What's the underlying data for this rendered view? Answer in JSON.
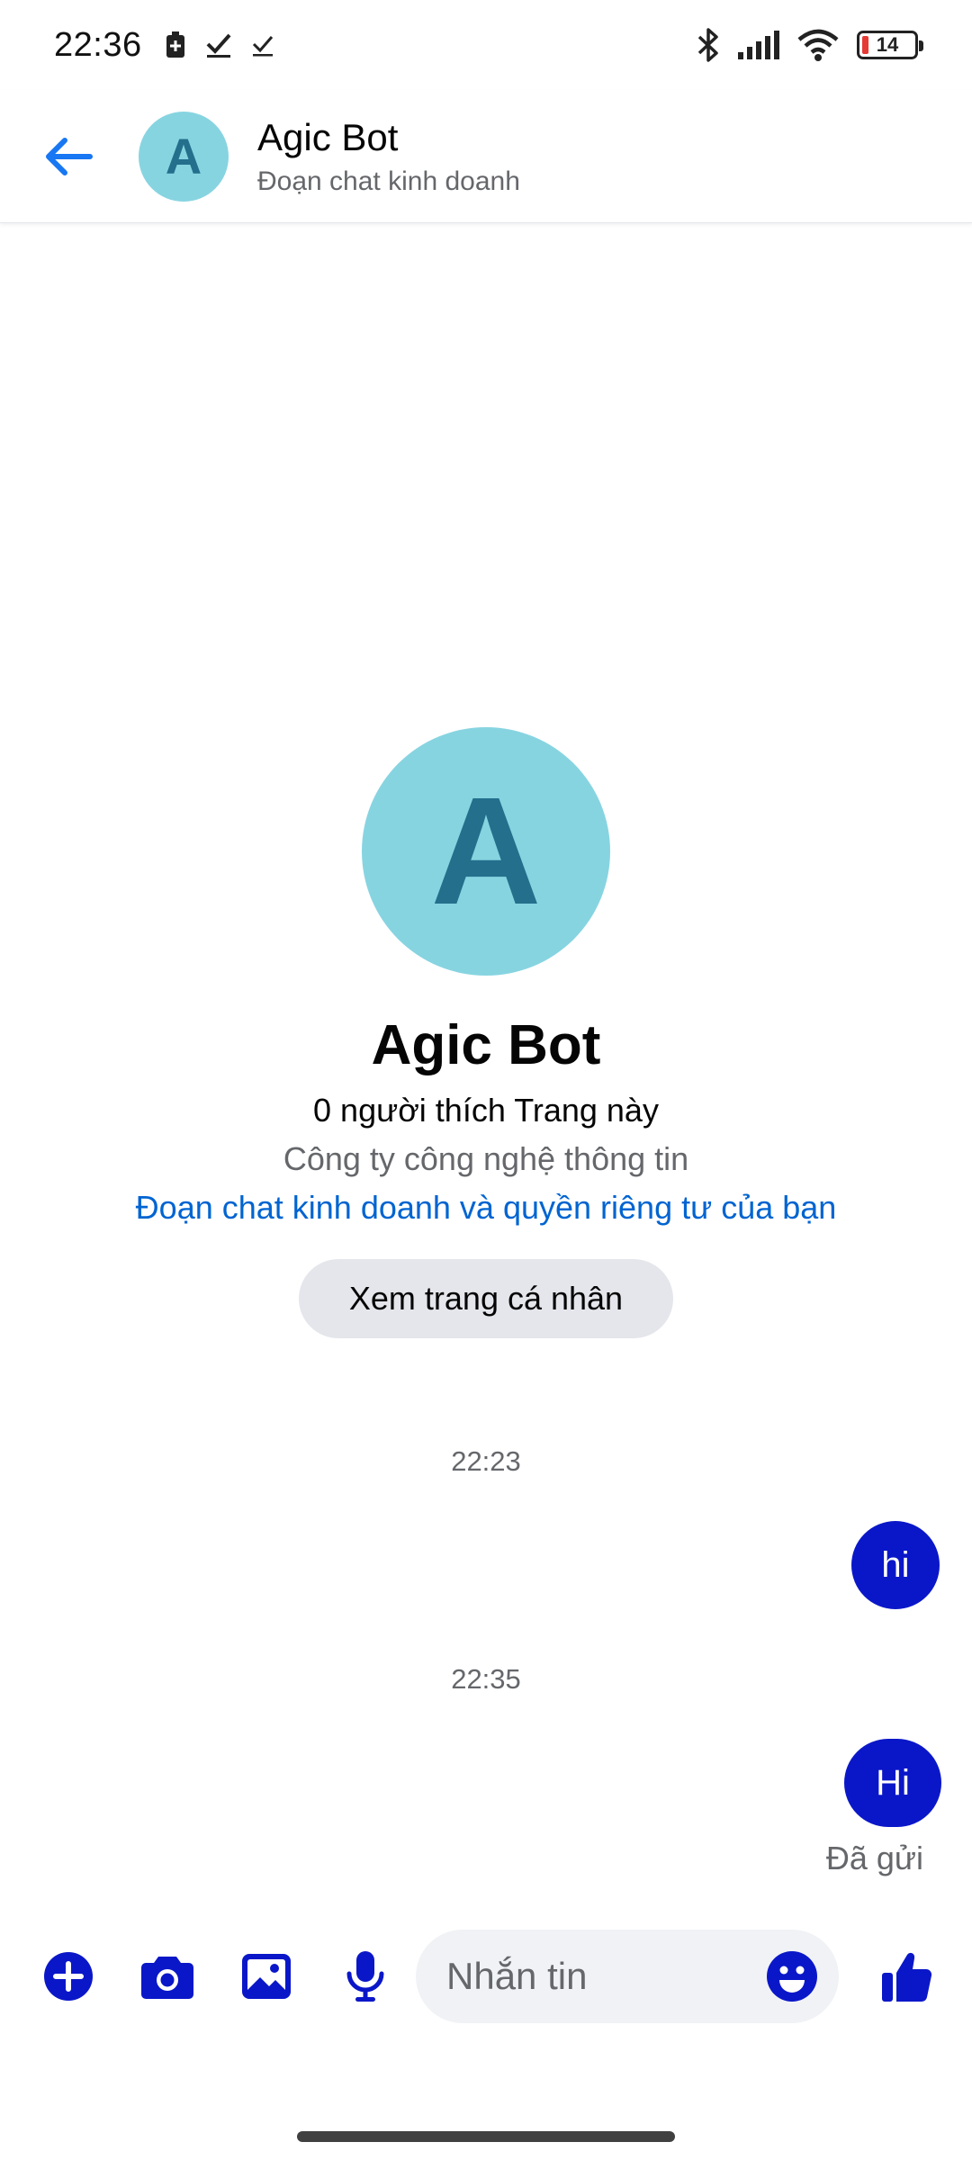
{
  "status_bar": {
    "time": "22:36",
    "battery_level": "14",
    "icons": [
      "battery-saver-icon",
      "check-icon",
      "check-icon",
      "bluetooth-icon",
      "signal-icon",
      "wifi-icon",
      "battery-icon"
    ]
  },
  "header": {
    "avatar_letter": "A",
    "title": "Agic Bot",
    "subtitle": "Đoạn chat kinh doanh"
  },
  "profile": {
    "avatar_letter": "A",
    "name": "Agic Bot",
    "likes": "0 người thích Trang này",
    "category": "Công ty công nghệ thông tin",
    "privacy_link": "Đoạn chat kinh doanh và quyền riêng tư của bạn",
    "view_profile_button": "Xem trang cá nhân"
  },
  "messages": [
    {
      "timestamp": "22:23",
      "text": "hi"
    },
    {
      "timestamp": "22:35",
      "text": "Hi"
    }
  ],
  "sent_status": "Đã gửi",
  "composer": {
    "placeholder": "Nhắn tin",
    "icons": [
      "plus-icon",
      "camera-icon",
      "image-icon",
      "mic-icon",
      "emoji-icon",
      "thumbs-up-icon"
    ]
  },
  "colors": {
    "accent": "#0a17c8",
    "link": "#0064d1",
    "avatar_bg": "#87d4e1",
    "avatar_fg": "#236f8c",
    "back_arrow": "#1877f2"
  }
}
